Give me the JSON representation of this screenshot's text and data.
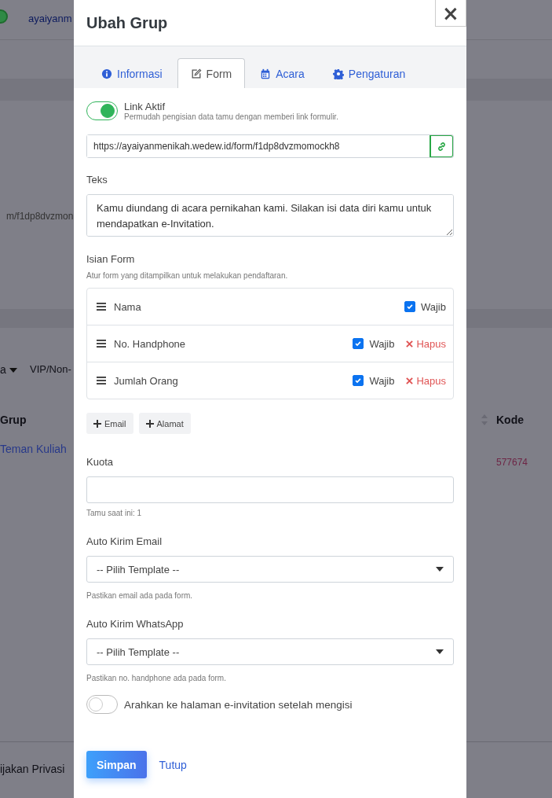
{
  "background": {
    "brand_text": "ayaiyanm",
    "url_text": "m/f1dp8dvzmon",
    "filter_1": "a",
    "filter_2": "VIP/Non-",
    "column_1": "Grup",
    "column_2": "Kode",
    "row": {
      "grup": "Teman Kuliah",
      "kode": "577674"
    },
    "footer_text": "ijakan Privasi"
  },
  "modal": {
    "title": "Ubah Grup",
    "close": "×",
    "tabs": [
      {
        "label": "Informasi",
        "selected": false
      },
      {
        "label": "Form",
        "selected": true
      },
      {
        "label": "Acara",
        "selected": false
      },
      {
        "label": "Pengaturan",
        "selected": false
      }
    ],
    "link_toggle": {
      "label": "Link Aktif",
      "hint": "Permudah pengisian data tamu dengan memberi link formulir.",
      "on": true
    },
    "link_url": "https://ayaiyanmenikah.wedew.id/form/f1dp8dvzmomockh8",
    "teks": {
      "label": "Teks",
      "value": "Kamu diundang di acara pernikahan kami. Silakan isi data diri kamu untuk mendapatkan e-Invitation."
    },
    "isian_form": {
      "label": "Isian Form",
      "hint": "Atur form yang ditampilkan untuk melakukan pendaftaran.",
      "fields": [
        {
          "name": "Nama",
          "required_label": "Wajib",
          "checked": true,
          "removable": false
        },
        {
          "name": "No. Handphone",
          "required_label": "Wajib",
          "checked": true,
          "remove_label": "Hapus",
          "removable": true
        },
        {
          "name": "Jumlah Orang",
          "required_label": "Wajib",
          "checked": true,
          "remove_label": "Hapus",
          "removable": true
        }
      ]
    },
    "add_buttons": [
      "Email",
      "Alamat"
    ],
    "kuota": {
      "label": "Kuota",
      "hint": "Tamu saat ini: 1"
    },
    "auto_email": {
      "label": "Auto Kirim Email",
      "value": "-- Pilih Template --",
      "hint": "Pastikan email ada pada form."
    },
    "auto_whatsapp": {
      "label": "Auto Kirim WhatsApp",
      "value": "-- Pilih Template --",
      "hint": "Pastikan no. handphone ada pada form."
    },
    "redirect_toggle": {
      "label": "Arahkan ke halaman e-invitation setelah mengisi",
      "on": false
    },
    "buttons": {
      "save": "Simpan",
      "close": "Tutup"
    }
  }
}
